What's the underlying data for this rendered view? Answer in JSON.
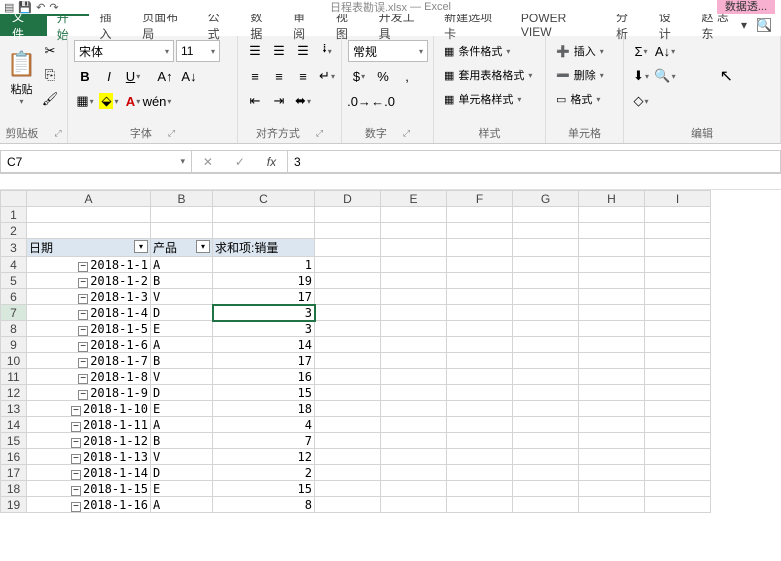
{
  "app": {
    "title": "日程表勘误.xlsx",
    "suffix": "— Excel",
    "context_tab": "数据透..."
  },
  "user": {
    "name": "赵 志东"
  },
  "menu": {
    "file": "文件",
    "tabs": [
      "开始",
      "插入",
      "页面布局",
      "公式",
      "数据",
      "审阅",
      "视图",
      "开发工具",
      "新建选项卡",
      "POWER VIEW",
      "分析",
      "设计"
    ],
    "active": 0
  },
  "ribbon": {
    "clipboard": {
      "paste": "粘贴",
      "label": "剪贴板"
    },
    "font": {
      "name": "宋体",
      "size": "11",
      "label": "字体"
    },
    "align": {
      "label": "对齐方式"
    },
    "number": {
      "format": "常规",
      "label": "数字"
    },
    "styles": {
      "cond": "条件格式",
      "table": "套用表格格式",
      "cell": "单元格样式",
      "label": "样式"
    },
    "cells": {
      "insert": "插入",
      "delete": "删除",
      "format": "格式",
      "label": "单元格"
    },
    "editing": {
      "label": "编辑"
    }
  },
  "namebox": "C7",
  "formula": "3",
  "columns": [
    "A",
    "B",
    "C",
    "D",
    "E",
    "F",
    "G",
    "H",
    "I"
  ],
  "pivot": {
    "headers": {
      "date": "日期",
      "product": "产品",
      "sum": "求和项:销量"
    },
    "rows": [
      {
        "date": "2018-1-1",
        "prod": "A",
        "val": "1"
      },
      {
        "date": "2018-1-2",
        "prod": "B",
        "val": "19"
      },
      {
        "date": "2018-1-3",
        "prod": "V",
        "val": "17"
      },
      {
        "date": "2018-1-4",
        "prod": "D",
        "val": "3"
      },
      {
        "date": "2018-1-5",
        "prod": "E",
        "val": "3"
      },
      {
        "date": "2018-1-6",
        "prod": "A",
        "val": "14"
      },
      {
        "date": "2018-1-7",
        "prod": "B",
        "val": "17"
      },
      {
        "date": "2018-1-8",
        "prod": "V",
        "val": "16"
      },
      {
        "date": "2018-1-9",
        "prod": "D",
        "val": "15"
      },
      {
        "date": "2018-1-10",
        "prod": "E",
        "val": "18"
      },
      {
        "date": "2018-1-11",
        "prod": "A",
        "val": "4"
      },
      {
        "date": "2018-1-12",
        "prod": "B",
        "val": "7"
      },
      {
        "date": "2018-1-13",
        "prod": "V",
        "val": "12"
      },
      {
        "date": "2018-1-14",
        "prod": "D",
        "val": "2"
      },
      {
        "date": "2018-1-15",
        "prod": "E",
        "val": "15"
      },
      {
        "date": "2018-1-16",
        "prod": "A",
        "val": "8"
      }
    ]
  },
  "selected_row": 7
}
